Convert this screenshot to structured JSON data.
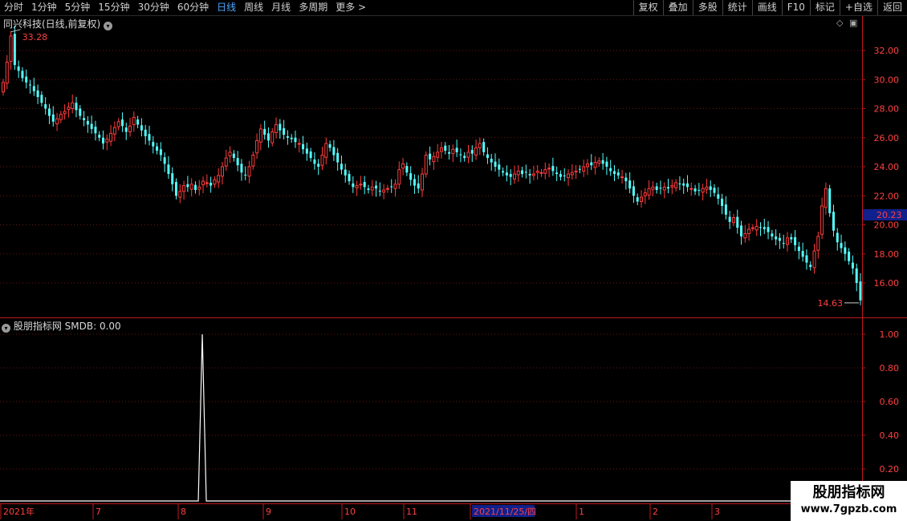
{
  "toolbar": {
    "tabs": [
      {
        "label": "分时"
      },
      {
        "label": "1分钟"
      },
      {
        "label": "5分钟"
      },
      {
        "label": "15分钟"
      },
      {
        "label": "30分钟"
      },
      {
        "label": "60分钟"
      },
      {
        "label": "日线",
        "active": true
      },
      {
        "label": "周线"
      },
      {
        "label": "月线"
      },
      {
        "label": "多周期"
      },
      {
        "label": "更多 >"
      }
    ],
    "actions": [
      {
        "label": "复权"
      },
      {
        "label": "叠加"
      },
      {
        "label": "多股"
      },
      {
        "label": "统计"
      },
      {
        "label": "画线"
      },
      {
        "label": "F10"
      },
      {
        "label": "标记"
      },
      {
        "label": "+自选"
      },
      {
        "label": "返回"
      }
    ]
  },
  "price_panel": {
    "title": "同兴科技(日线,前复权)",
    "high_label": "33.28",
    "low_label": "14.63",
    "current_price": "20.23"
  },
  "indicator_panel": {
    "title": "股朋指标网  SMDB: 0.00"
  },
  "watermark": {
    "title": "股朋指标网",
    "url": "www.7gpzb.com"
  },
  "colors": {
    "up": "#ff3c3c",
    "down": "#54ffff",
    "axis": "#c0181c",
    "grid": "#6a1414",
    "label_highlight_bg": "#10208c"
  },
  "chart_data": [
    {
      "type": "candlestick",
      "x_ticks": [
        "2021年",
        "7",
        "8",
        "9",
        "10",
        "11",
        "2021/11/25/四",
        "1",
        "2",
        "3"
      ],
      "y_ticks": [
        "32.00",
        "30.00",
        "28.00",
        "26.00",
        "24.00",
        "22.00",
        "20.00",
        "18.00",
        "16.00"
      ],
      "ylim": [
        14.3,
        34.2
      ],
      "closes": [
        29.8,
        31.2,
        33.0,
        31.0,
        30.6,
        30.1,
        29.8,
        29.6,
        29.2,
        28.8,
        28.4,
        28.0,
        27.5,
        27.1,
        27.3,
        27.6,
        27.8,
        28.1,
        28.4,
        27.9,
        27.5,
        27.2,
        26.9,
        26.6,
        26.3,
        26.0,
        25.6,
        25.9,
        26.3,
        26.7,
        27.1,
        26.8,
        26.4,
        26.8,
        27.4,
        26.9,
        26.5,
        26.1,
        25.8,
        25.4,
        25.1,
        24.8,
        24.2,
        23.5,
        22.8,
        22.0,
        22.3,
        22.7,
        22.6,
        22.8,
        22.4,
        22.6,
        23.0,
        22.9,
        22.7,
        23.1,
        23.4,
        24.0,
        24.6,
        25.0,
        24.6,
        24.1,
        23.6,
        23.4,
        24.0,
        24.8,
        25.8,
        26.6,
        26.2,
        25.8,
        26.4,
        26.9,
        26.5,
        26.2,
        26.0,
        25.9,
        25.7,
        25.6,
        25.2,
        24.9,
        24.6,
        24.2,
        24.0,
        24.8,
        25.6,
        25.3,
        24.8,
        24.3,
        23.8,
        23.4,
        23.0,
        22.6,
        22.7,
        22.8,
        22.6,
        22.4,
        22.6,
        22.5,
        22.3,
        22.4,
        22.5,
        22.6,
        22.8,
        23.8,
        24.2,
        23.6,
        23.1,
        22.7,
        22.5,
        23.5,
        24.8,
        24.5,
        24.7,
        25.0,
        25.3,
        25.1,
        24.9,
        25.2,
        25.0,
        24.8,
        24.6,
        25.0,
        24.9,
        25.3,
        25.6,
        25.0,
        24.6,
        24.3,
        24.0,
        23.8,
        23.6,
        23.4,
        23.3,
        23.5,
        23.7,
        23.5,
        23.6,
        23.4,
        23.5,
        23.7,
        23.6,
        23.8,
        23.9,
        23.7,
        23.5,
        23.3,
        23.4,
        23.5,
        23.6,
        23.7,
        23.8,
        24.0,
        24.2,
        24.1,
        24.3,
        24.4,
        24.2,
        24.0,
        23.7,
        23.5,
        23.4,
        23.3,
        23.0,
        22.5,
        22.0,
        21.6,
        21.9,
        22.2,
        22.5,
        22.6,
        22.4,
        22.5,
        22.6,
        22.5,
        22.7,
        22.9,
        22.8,
        22.7,
        22.6,
        22.5,
        22.3,
        22.4,
        22.5,
        22.6,
        22.4,
        22.2,
        21.8,
        21.3,
        20.7,
        20.2,
        20.5,
        19.8,
        19.2,
        19.4,
        19.7,
        19.8,
        19.9,
        19.8,
        19.7,
        19.5,
        19.2,
        19.0,
        18.9,
        18.7,
        19.1,
        19.0,
        18.6,
        18.2,
        17.8,
        17.4,
        17.1,
        18.2,
        19.2,
        21.3,
        22.5,
        20.8,
        19.6,
        18.8,
        18.4,
        18.0,
        17.5,
        17.0,
        16.0,
        14.8
      ]
    },
    {
      "type": "line",
      "series": [
        {
          "name": "SMDB"
        }
      ],
      "y_ticks": [
        "1.00",
        "0.80",
        "0.60",
        "0.40",
        "0.20"
      ],
      "ylim": [
        -0.05,
        1.02
      ],
      "spike_index": 52,
      "spike_value": 1.0,
      "baseline": 0
    }
  ]
}
